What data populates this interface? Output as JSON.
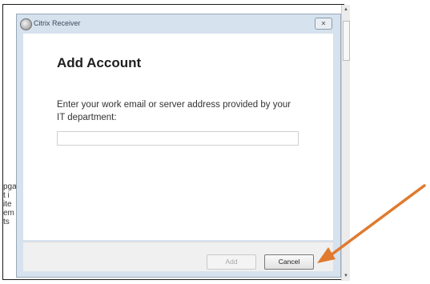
{
  "window": {
    "title": "Citrix Receiver",
    "close_glyph": "✕"
  },
  "dialog": {
    "heading": "Add Account",
    "instructions": "Enter your work email or server address provided by your IT department:",
    "server_input": {
      "value": "",
      "placeholder": ""
    },
    "add_label": "Add",
    "cancel_label": "Cancel"
  },
  "background_doc": {
    "text_fragments": [
      "pga",
      "t i",
      "ite",
      "em",
      "ts"
    ]
  },
  "annotation": {
    "arrow_color": "#e07a2e",
    "arrow_target": "cancel-button"
  },
  "icons": {
    "app": "citrix-receiver-icon",
    "close": "close-icon"
  }
}
